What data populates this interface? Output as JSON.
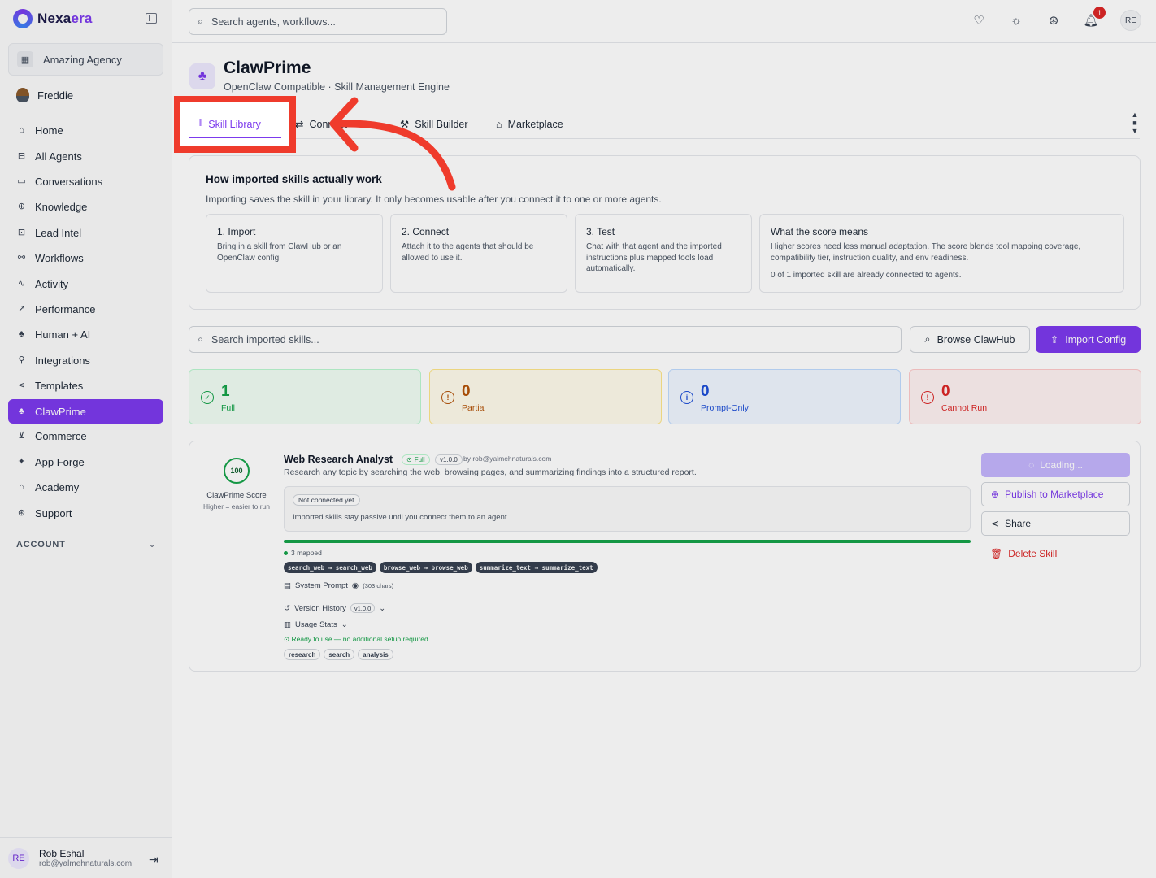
{
  "brand": {
    "name_main": "Nexa",
    "name_accent": "era"
  },
  "sidebar": {
    "agency": "Amazing Agency",
    "user": "Freddie",
    "items": [
      {
        "label": "Home",
        "icon": "home-icon",
        "glyph": "⌂"
      },
      {
        "label": "All Agents",
        "icon": "robot-icon",
        "glyph": "⊟"
      },
      {
        "label": "Conversations",
        "icon": "chat-icon",
        "glyph": "▭"
      },
      {
        "label": "Knowledge",
        "icon": "brain-icon",
        "glyph": "⊕"
      },
      {
        "label": "Lead Intel",
        "icon": "target-icon",
        "glyph": "⊡"
      },
      {
        "label": "Workflows",
        "icon": "workflow-icon",
        "glyph": "⚯"
      },
      {
        "label": "Activity",
        "icon": "activity-icon",
        "glyph": "∿"
      },
      {
        "label": "Performance",
        "icon": "trending-icon",
        "glyph": "↗"
      },
      {
        "label": "Human + AI",
        "icon": "network-icon",
        "glyph": "♣"
      },
      {
        "label": "Integrations",
        "icon": "plug-icon",
        "glyph": "⚲"
      },
      {
        "label": "Templates",
        "icon": "share-icon",
        "glyph": "⋖"
      },
      {
        "label": "ClawPrime",
        "icon": "clawprime-icon",
        "glyph": "♣",
        "active": true
      },
      {
        "label": "Commerce",
        "icon": "cart-icon",
        "glyph": "⊻"
      },
      {
        "label": "App Forge",
        "icon": "sparkles-icon",
        "glyph": "✦"
      },
      {
        "label": "Academy",
        "icon": "graduation-cap-icon",
        "glyph": "⌂"
      },
      {
        "label": "Support",
        "icon": "lifebuoy-icon",
        "glyph": "⊛"
      }
    ],
    "account_label": "ACCOUNT",
    "footer": {
      "initials": "RE",
      "name": "Rob Eshal",
      "email": "rob@yalmehnaturals.com"
    }
  },
  "topbar": {
    "search_placeholder": "Search agents, workflows...",
    "notifications_count": "1",
    "avatar_initials": "RE"
  },
  "header": {
    "title": "ClawPrime",
    "subtitle": "OpenClaw Compatible · Skill Management Engine"
  },
  "tabs": [
    {
      "label": "Skill Library",
      "icon": "library-icon",
      "active": true
    },
    {
      "label": "Connect",
      "icon": "connect-icon"
    },
    {
      "label": "Skill Builder",
      "icon": "wrench-icon"
    },
    {
      "label": "Marketplace",
      "icon": "store-icon"
    }
  ],
  "info": {
    "title": "How imported skills actually work",
    "subtitle": "Importing saves the skill in your library. It only becomes usable after you connect it to one or more agents.",
    "steps": [
      {
        "title": "1. Import",
        "desc": "Bring in a skill from ClawHub or an OpenClaw config."
      },
      {
        "title": "2. Connect",
        "desc": "Attach it to the agents that should be allowed to use it."
      },
      {
        "title": "3. Test",
        "desc": "Chat with that agent and the imported instructions plus mapped tools load automatically."
      },
      {
        "title": "What the score means",
        "desc": "Higher scores need less manual adaptation. The score blends tool mapping coverage, compatibility tier, instruction quality, and env readiness.",
        "note": "0 of 1 imported skill are already connected to agents."
      }
    ]
  },
  "library": {
    "search_placeholder": "Search imported skills...",
    "browse_label": "Browse ClawHub",
    "import_label": "Import Config"
  },
  "stats": [
    {
      "value": "1",
      "label": "Full",
      "color": "#16a34a",
      "bg": "#f0fdf4",
      "border": "#bbf7d0",
      "icon": "check-circle-icon",
      "glyph": "✓"
    },
    {
      "value": "0",
      "label": "Partial",
      "color": "#b45309",
      "bg": "#fffbeb",
      "border": "#fde68a",
      "icon": "warning-icon",
      "glyph": "!"
    },
    {
      "value": "0",
      "label": "Prompt-Only",
      "color": "#1d4ed8",
      "bg": "#eff6ff",
      "border": "#bfdbfe",
      "icon": "info-icon",
      "glyph": "i"
    },
    {
      "value": "0",
      "label": "Cannot Run",
      "color": "#dc2626",
      "bg": "#fef2f2",
      "border": "#fecaca",
      "icon": "alert-circle-icon",
      "glyph": "!"
    }
  ],
  "skill": {
    "score": "100",
    "score_label": "ClawPrime Score",
    "score_hint": "Higher = easier to run",
    "name": "Web Research Analyst",
    "tier": "Full",
    "version": "v1.0.0",
    "author": "by rob@yalmehnaturals.com",
    "description": "Research any topic by searching the web, browsing pages, and summarizing findings into a structured report.",
    "conn_status": "Not connected yet",
    "conn_text": "Imported skills stay passive until you connect them to an agent.",
    "mapping_progress": 1.0,
    "mapped": "3 mapped",
    "tools": [
      "search_web → search_web",
      "browse_web → browse_web",
      "summarize_text → summarize_text"
    ],
    "system_prompt": "System Prompt",
    "prompt_chars": "(303 chars)",
    "version_history": "Version History",
    "usage_stats": "Usage Stats",
    "ready": "Ready to use — no additional setup required",
    "tags": [
      "research",
      "search",
      "analysis"
    ],
    "actions": {
      "loading": "Loading...",
      "publish": "Publish to Marketplace",
      "share": "Share",
      "delete": "Delete Skill"
    }
  }
}
